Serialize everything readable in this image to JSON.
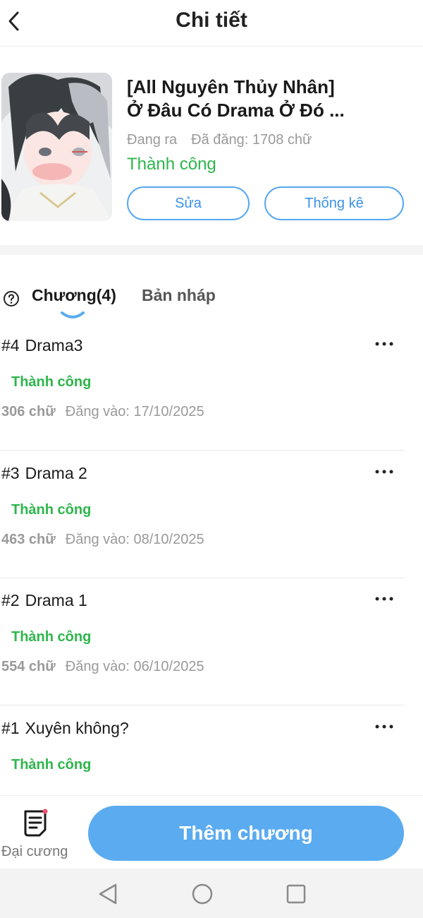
{
  "header": {
    "title": "Chi tiết"
  },
  "book": {
    "title_line1": "[All Nguyên Thủy Nhân]",
    "title_line2": "Ở Đâu Có Drama Ở Đó ...",
    "state": "Đang ra",
    "posted_words": "Đã đăng: 1708 chữ",
    "status": "Thành công",
    "edit_label": "Sửa",
    "stats_label": "Thống kê"
  },
  "tabs": {
    "chapters_label": "Chương(4)",
    "drafts_label": "Bản nháp"
  },
  "chapters": [
    {
      "num": "#4",
      "title": "Drama3",
      "status": "Thành công",
      "words": "306 chữ",
      "date_label": "Đăng vào:",
      "date": "17/10/2025"
    },
    {
      "num": "#3",
      "title": "Drama 2",
      "status": "Thành công",
      "words": "463 chữ",
      "date_label": "Đăng vào:",
      "date": "08/10/2025"
    },
    {
      "num": "#2",
      "title": "Drama 1",
      "status": "Thành công",
      "words": "554 chữ",
      "date_label": "Đăng vào:",
      "date": "06/10/2025"
    },
    {
      "num": "#1",
      "title": "Xuyên không?",
      "status": "Thành công",
      "words": "",
      "date_label": "",
      "date": ""
    }
  ],
  "bottom": {
    "outline_label": "Đại cương",
    "add_chapter_label": "Thêm chương"
  },
  "colors": {
    "accent": "#5aabf0",
    "success": "#2db64b",
    "badge": "#f0506e"
  }
}
